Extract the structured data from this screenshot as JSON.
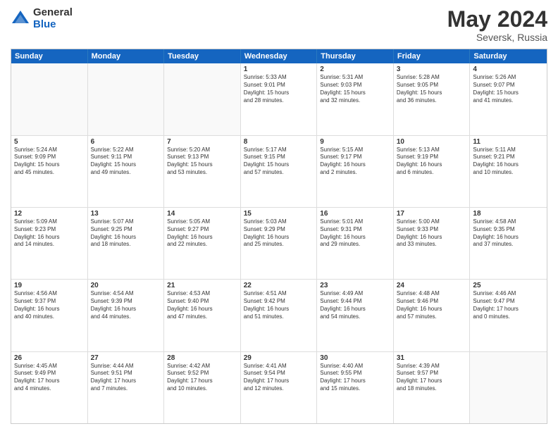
{
  "logo": {
    "general": "General",
    "blue": "Blue"
  },
  "header": {
    "title": "May 2024",
    "subtitle": "Seversk, Russia"
  },
  "weekdays": [
    "Sunday",
    "Monday",
    "Tuesday",
    "Wednesday",
    "Thursday",
    "Friday",
    "Saturday"
  ],
  "rows": [
    [
      {
        "day": "",
        "text": ""
      },
      {
        "day": "",
        "text": ""
      },
      {
        "day": "",
        "text": ""
      },
      {
        "day": "1",
        "text": "Sunrise: 5:33 AM\nSunset: 9:01 PM\nDaylight: 15 hours\nand 28 minutes."
      },
      {
        "day": "2",
        "text": "Sunrise: 5:31 AM\nSunset: 9:03 PM\nDaylight: 15 hours\nand 32 minutes."
      },
      {
        "day": "3",
        "text": "Sunrise: 5:28 AM\nSunset: 9:05 PM\nDaylight: 15 hours\nand 36 minutes."
      },
      {
        "day": "4",
        "text": "Sunrise: 5:26 AM\nSunset: 9:07 PM\nDaylight: 15 hours\nand 41 minutes."
      }
    ],
    [
      {
        "day": "5",
        "text": "Sunrise: 5:24 AM\nSunset: 9:09 PM\nDaylight: 15 hours\nand 45 minutes."
      },
      {
        "day": "6",
        "text": "Sunrise: 5:22 AM\nSunset: 9:11 PM\nDaylight: 15 hours\nand 49 minutes."
      },
      {
        "day": "7",
        "text": "Sunrise: 5:20 AM\nSunset: 9:13 PM\nDaylight: 15 hours\nand 53 minutes."
      },
      {
        "day": "8",
        "text": "Sunrise: 5:17 AM\nSunset: 9:15 PM\nDaylight: 15 hours\nand 57 minutes."
      },
      {
        "day": "9",
        "text": "Sunrise: 5:15 AM\nSunset: 9:17 PM\nDaylight: 16 hours\nand 2 minutes."
      },
      {
        "day": "10",
        "text": "Sunrise: 5:13 AM\nSunset: 9:19 PM\nDaylight: 16 hours\nand 6 minutes."
      },
      {
        "day": "11",
        "text": "Sunrise: 5:11 AM\nSunset: 9:21 PM\nDaylight: 16 hours\nand 10 minutes."
      }
    ],
    [
      {
        "day": "12",
        "text": "Sunrise: 5:09 AM\nSunset: 9:23 PM\nDaylight: 16 hours\nand 14 minutes."
      },
      {
        "day": "13",
        "text": "Sunrise: 5:07 AM\nSunset: 9:25 PM\nDaylight: 16 hours\nand 18 minutes."
      },
      {
        "day": "14",
        "text": "Sunrise: 5:05 AM\nSunset: 9:27 PM\nDaylight: 16 hours\nand 22 minutes."
      },
      {
        "day": "15",
        "text": "Sunrise: 5:03 AM\nSunset: 9:29 PM\nDaylight: 16 hours\nand 25 minutes."
      },
      {
        "day": "16",
        "text": "Sunrise: 5:01 AM\nSunset: 9:31 PM\nDaylight: 16 hours\nand 29 minutes."
      },
      {
        "day": "17",
        "text": "Sunrise: 5:00 AM\nSunset: 9:33 PM\nDaylight: 16 hours\nand 33 minutes."
      },
      {
        "day": "18",
        "text": "Sunrise: 4:58 AM\nSunset: 9:35 PM\nDaylight: 16 hours\nand 37 minutes."
      }
    ],
    [
      {
        "day": "19",
        "text": "Sunrise: 4:56 AM\nSunset: 9:37 PM\nDaylight: 16 hours\nand 40 minutes."
      },
      {
        "day": "20",
        "text": "Sunrise: 4:54 AM\nSunset: 9:39 PM\nDaylight: 16 hours\nand 44 minutes."
      },
      {
        "day": "21",
        "text": "Sunrise: 4:53 AM\nSunset: 9:40 PM\nDaylight: 16 hours\nand 47 minutes."
      },
      {
        "day": "22",
        "text": "Sunrise: 4:51 AM\nSunset: 9:42 PM\nDaylight: 16 hours\nand 51 minutes."
      },
      {
        "day": "23",
        "text": "Sunrise: 4:49 AM\nSunset: 9:44 PM\nDaylight: 16 hours\nand 54 minutes."
      },
      {
        "day": "24",
        "text": "Sunrise: 4:48 AM\nSunset: 9:46 PM\nDaylight: 16 hours\nand 57 minutes."
      },
      {
        "day": "25",
        "text": "Sunrise: 4:46 AM\nSunset: 9:47 PM\nDaylight: 17 hours\nand 0 minutes."
      }
    ],
    [
      {
        "day": "26",
        "text": "Sunrise: 4:45 AM\nSunset: 9:49 PM\nDaylight: 17 hours\nand 4 minutes."
      },
      {
        "day": "27",
        "text": "Sunrise: 4:44 AM\nSunset: 9:51 PM\nDaylight: 17 hours\nand 7 minutes."
      },
      {
        "day": "28",
        "text": "Sunrise: 4:42 AM\nSunset: 9:52 PM\nDaylight: 17 hours\nand 10 minutes."
      },
      {
        "day": "29",
        "text": "Sunrise: 4:41 AM\nSunset: 9:54 PM\nDaylight: 17 hours\nand 12 minutes."
      },
      {
        "day": "30",
        "text": "Sunrise: 4:40 AM\nSunset: 9:55 PM\nDaylight: 17 hours\nand 15 minutes."
      },
      {
        "day": "31",
        "text": "Sunrise: 4:39 AM\nSunset: 9:57 PM\nDaylight: 17 hours\nand 18 minutes."
      },
      {
        "day": "",
        "text": ""
      }
    ]
  ]
}
